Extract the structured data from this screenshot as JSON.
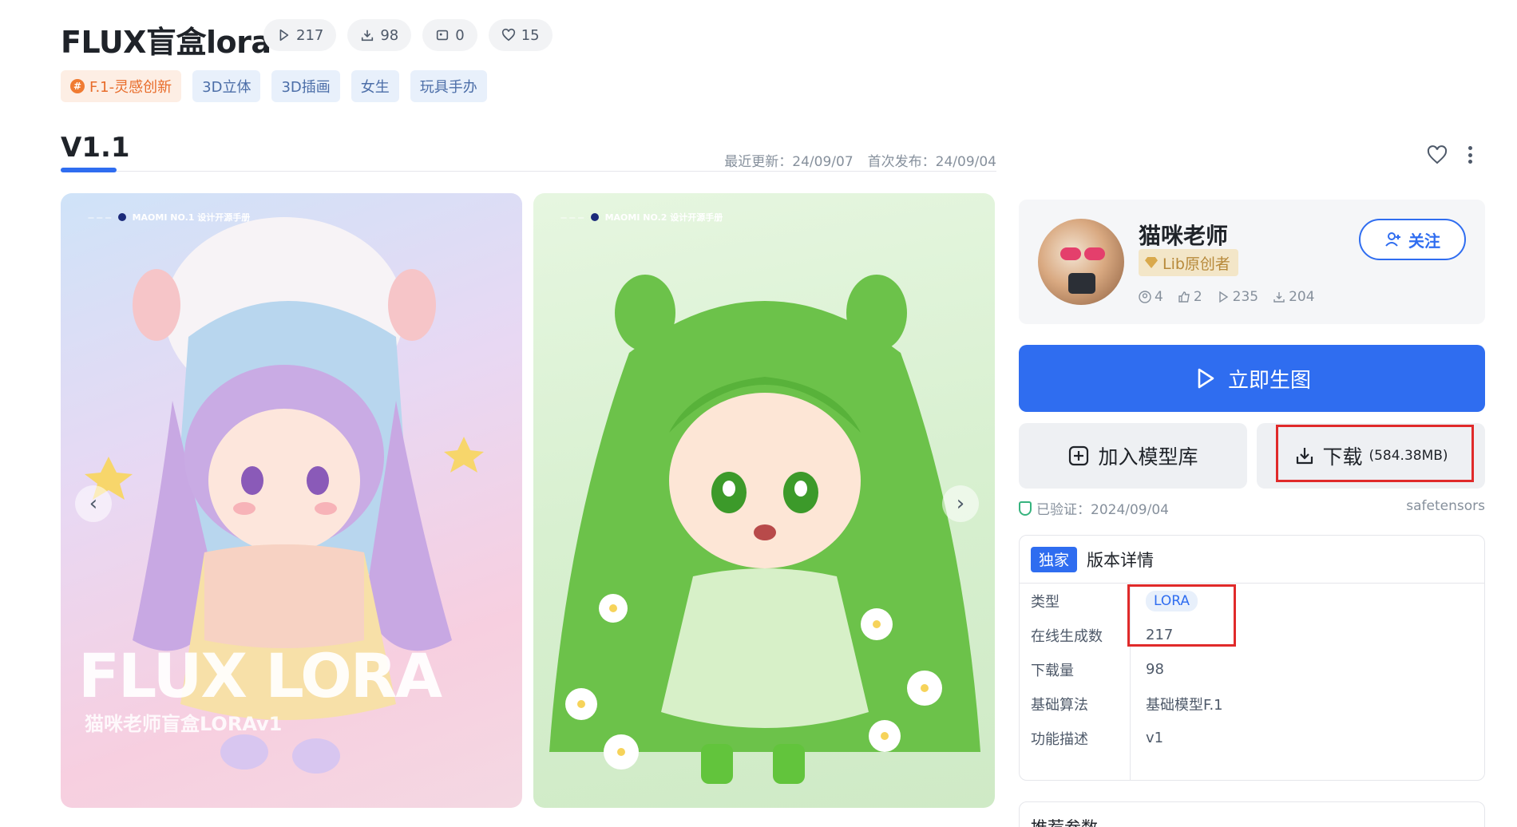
{
  "model": {
    "title": "FLUX盲盒lora",
    "stats": {
      "runs": "217",
      "downloads": "98",
      "images": "0",
      "likes": "15"
    },
    "tags": [
      "F.1-灵感创新",
      "3D立体",
      "3D插画",
      "女生",
      "玩具手办"
    ]
  },
  "version": {
    "name": "V1.1",
    "updated": "最近更新：24/09/07",
    "published": "首次发布：24/09/04"
  },
  "gallery": {
    "image1": {
      "header": "MAOMI NO.1 设计开源手册",
      "overlay_title": "FLUX LORA",
      "overlay_sub": "猫咪老师盲盒LORAv1"
    },
    "image2": {
      "header": "MAOMI NO.2 设计开源手册"
    }
  },
  "creator": {
    "name": "猫咪老师",
    "badge": "Lib原创者",
    "follow_label": "关注",
    "stats": {
      "followers": "4",
      "likes": "2",
      "runs": "235",
      "downloads": "204"
    }
  },
  "actions": {
    "generate_label": "立即生图",
    "add_label": "加入模型库",
    "download_label": "下载",
    "download_size": "(584.38MB)"
  },
  "verification": {
    "text": "已验证：2024/09/04",
    "format": "safetensors"
  },
  "details": {
    "exclusive_label": "独家",
    "title": "版本详情",
    "rows": [
      {
        "key": "类型",
        "value": "LORA"
      },
      {
        "key": "在线生成数",
        "value": "217"
      },
      {
        "key": "下载量",
        "value": "98"
      },
      {
        "key": "基础算法",
        "value": "基础模型F.1"
      },
      {
        "key": "功能描述",
        "value": "v1"
      }
    ]
  },
  "params": {
    "title": "推荐参数"
  },
  "colors": {
    "primary": "#2f6df0",
    "highlight": "#e02a2a"
  }
}
